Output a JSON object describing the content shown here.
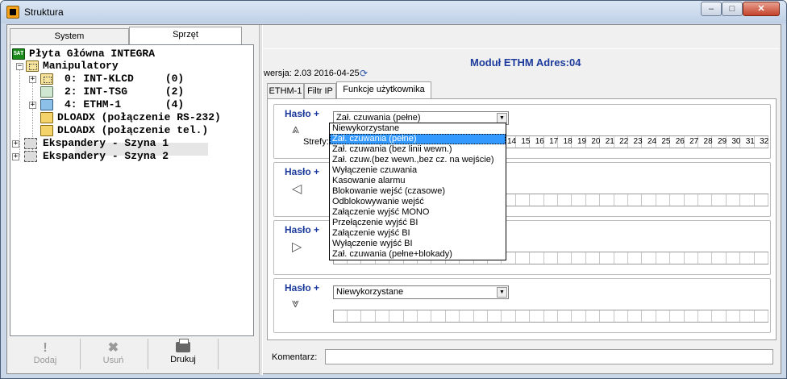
{
  "window": {
    "title": "Struktura",
    "controls": {
      "minimize": "–",
      "maximize": "□",
      "close": "✕"
    }
  },
  "left_panel": {
    "tabs": [
      "System",
      "Sprzęt"
    ],
    "active_tab": "Sprzęt",
    "tree": [
      {
        "label": "Płyta Główna INTEGRA",
        "icon": "mainboard-icon"
      },
      {
        "label": "Manipulatory",
        "icon": "keypad-group-icon",
        "expanded": true
      },
      {
        "label": "0: INT-KLCD     (0)",
        "icon": "lcd-keypad-icon"
      },
      {
        "label": "2: INT-TSG      (2)",
        "icon": "touch-keypad-icon"
      },
      {
        "label": "4: ETHM-1       (4)",
        "icon": "ethernet-module-icon",
        "selected": true
      },
      {
        "label": "DLOADX (połączenie RS-232)",
        "icon": "dloadx-icon"
      },
      {
        "label": "DLOADX (połączenie tel.)",
        "icon": "dloadx-icon"
      },
      {
        "label": "Ekspandery - Szyna 1",
        "icon": "expander-bus-icon"
      },
      {
        "label": "Ekspandery - Szyna 2",
        "icon": "expander-bus-icon"
      }
    ],
    "buttons": {
      "add": "Dodaj",
      "delete": "Usuń",
      "print": "Drukuj"
    }
  },
  "right_panel": {
    "module_title": "Moduł ETHM Adres:04",
    "version": "wersja: 2.03 2016-04-25",
    "tabs": [
      "ETHM-1",
      "Filtr IP",
      "Funkcje użytkownika"
    ],
    "active_tab": "Funkcje użytkownika",
    "groups": [
      {
        "label": "Hasło +",
        "arrow": "up",
        "value": "Zał. czuwania (pełne)"
      },
      {
        "label": "Hasło +",
        "arrow": "left",
        "value": ""
      },
      {
        "label": "Hasło +",
        "arrow": "right",
        "value": ""
      },
      {
        "label": "Hasło +",
        "arrow": "down",
        "value": "Niewykorzystane"
      }
    ],
    "zones_label": "Strefy:",
    "zone_numbers_visible": [
      "14",
      "15",
      "16",
      "17",
      "18",
      "19",
      "20",
      "21",
      "22",
      "23",
      "24",
      "25",
      "26",
      "27",
      "28",
      "29",
      "30",
      "31",
      "32"
    ],
    "dropdown_options": [
      "Niewykorzystane",
      "Zał. czuwania (pełne)",
      "Zał. czuwania (bez linii wewn.)",
      "Zał. czuw.(bez wewn.,bez cz. na wejście)",
      "Wyłączenie czuwania",
      "Kasowanie alarmu",
      "Blokowanie wejść (czasowe)",
      "Odblokowywanie wejść",
      "Załączenie wyjść MONO",
      "Przełączenie wyjść BI",
      "Załączenie wyjść BI",
      "Wyłączenie wyjść BI",
      "Zał. czuwania (pełne+blokady)"
    ],
    "dropdown_selected": "Zał. czuwania (pełne)",
    "comment_label": "Komentarz:",
    "comment_value": ""
  },
  "colors": {
    "title_blue": "#1c3b9c",
    "selection": "#3399ff"
  }
}
